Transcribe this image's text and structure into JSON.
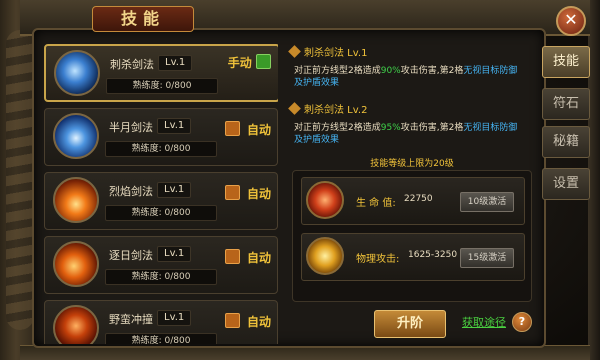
{
  "window": {
    "title": "技能",
    "close_icon": "close-icon"
  },
  "skills": [
    {
      "name": "刺杀剑法",
      "level": "Lv.1",
      "proficiency_label": "熟练度:",
      "proficiency": "0/800",
      "mode": "手动",
      "mode_color": "#3a9a28",
      "icon": "sword-thrust-icon",
      "selected": true
    },
    {
      "name": "半月剑法",
      "level": "Lv.1",
      "proficiency_label": "熟练度:",
      "proficiency": "0/800",
      "mode": "自动",
      "mode_color": "#b8641a",
      "icon": "half-moon-slash-icon",
      "selected": false
    },
    {
      "name": "烈焰剑法",
      "level": "Lv.1",
      "proficiency_label": "熟练度:",
      "proficiency": "0/800",
      "mode": "自动",
      "mode_color": "#b8641a",
      "icon": "flame-sword-icon",
      "selected": false
    },
    {
      "name": "逐日剑法",
      "level": "Lv.1",
      "proficiency_label": "熟练度:",
      "proficiency": "0/800",
      "mode": "自动",
      "mode_color": "#b8641a",
      "icon": "sun-chaser-icon",
      "selected": false
    },
    {
      "name": "野蛮冲撞",
      "level": "Lv.1",
      "proficiency_label": "熟练度:",
      "proficiency": "0/800",
      "mode": "自动",
      "mode_color": "#b8641a",
      "icon": "savage-charge-icon",
      "selected": false
    }
  ],
  "detail": {
    "lv1_title": "刺杀剑法 Lv.1",
    "lv1_text_a": "对正前方线型2格造成",
    "lv1_pct": "90%",
    "lv1_text_b": "攻击伤害,第2格",
    "lv1_ignore": "无视目标防御",
    "lv1_text_c": "及护盾效果",
    "lv2_title": "刺杀剑法 Lv.2",
    "lv2_text_a": "对正前方线型2格造成",
    "lv2_pct": "95%",
    "lv2_text_b": "攻击伤害,第2格",
    "lv2_ignore": "无视目标防御",
    "lv2_text_c": "及护盾效果",
    "cap": "技能等级上限为20级"
  },
  "stats": [
    {
      "label": "生 命 值:",
      "value": "22750",
      "button": "10级激活",
      "icon": "hp-dragon-icon"
    },
    {
      "label": "物理攻击:",
      "value": "1625-3250",
      "button": "15级激活",
      "icon": "attack-flame-icon"
    }
  ],
  "tabs": [
    "技能",
    "符石",
    "秘籍",
    "设置"
  ],
  "active_tab": "技能",
  "actions": {
    "upgrade": "升阶",
    "get_path": "获取途径",
    "help": "?"
  }
}
